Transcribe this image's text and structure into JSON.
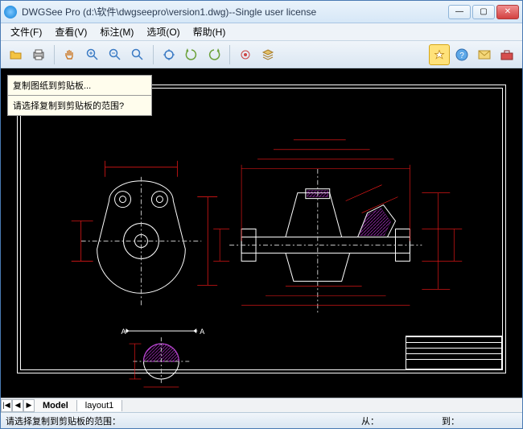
{
  "window": {
    "title": "DWGSee Pro (d:\\软件\\dwgseepro\\version1.dwg)--Single user license"
  },
  "menu": {
    "file": "文件(F)",
    "view": "查看(V)",
    "annotate": "标注(M)",
    "options": "选项(O)",
    "help": "帮助(H)"
  },
  "toolbar_icons": {
    "open": "open-folder-icon",
    "print": "printer-icon",
    "pan": "hand-icon",
    "zoom_in": "zoom-in-icon",
    "zoom_out": "zoom-out-icon",
    "zoom_window": "zoom-window-icon",
    "zoom_extents": "zoom-extents-icon",
    "rotate_ccw": "rotate-ccw-icon",
    "rotate_cw": "rotate-cw-icon",
    "target": "target-icon",
    "layers": "layers-icon",
    "favorite": "star-icon",
    "help": "help-icon",
    "mail": "mail-icon",
    "toolbox": "toolbox-icon"
  },
  "tooltip": {
    "title": "复制图纸到剪贴板...",
    "body": "请选择复制到剪贴板的范围?"
  },
  "tabs": {
    "nav_first": "|◀",
    "nav_prev": "◀",
    "nav_next": "▶",
    "model": "Model",
    "layout1": "layout1"
  },
  "status": {
    "prompt": "请选择复制到剪贴板的范围：",
    "from_label": "从：",
    "to_label": "到：",
    "from_value": "",
    "to_value": ""
  },
  "drawing": {
    "section_label_a_left": "A",
    "section_label_a_right": "A",
    "colors": {
      "dim": "#ff1a1a",
      "body": "#ffffff",
      "hatch": "#b933d4",
      "axis": "#c0c0c0"
    }
  }
}
